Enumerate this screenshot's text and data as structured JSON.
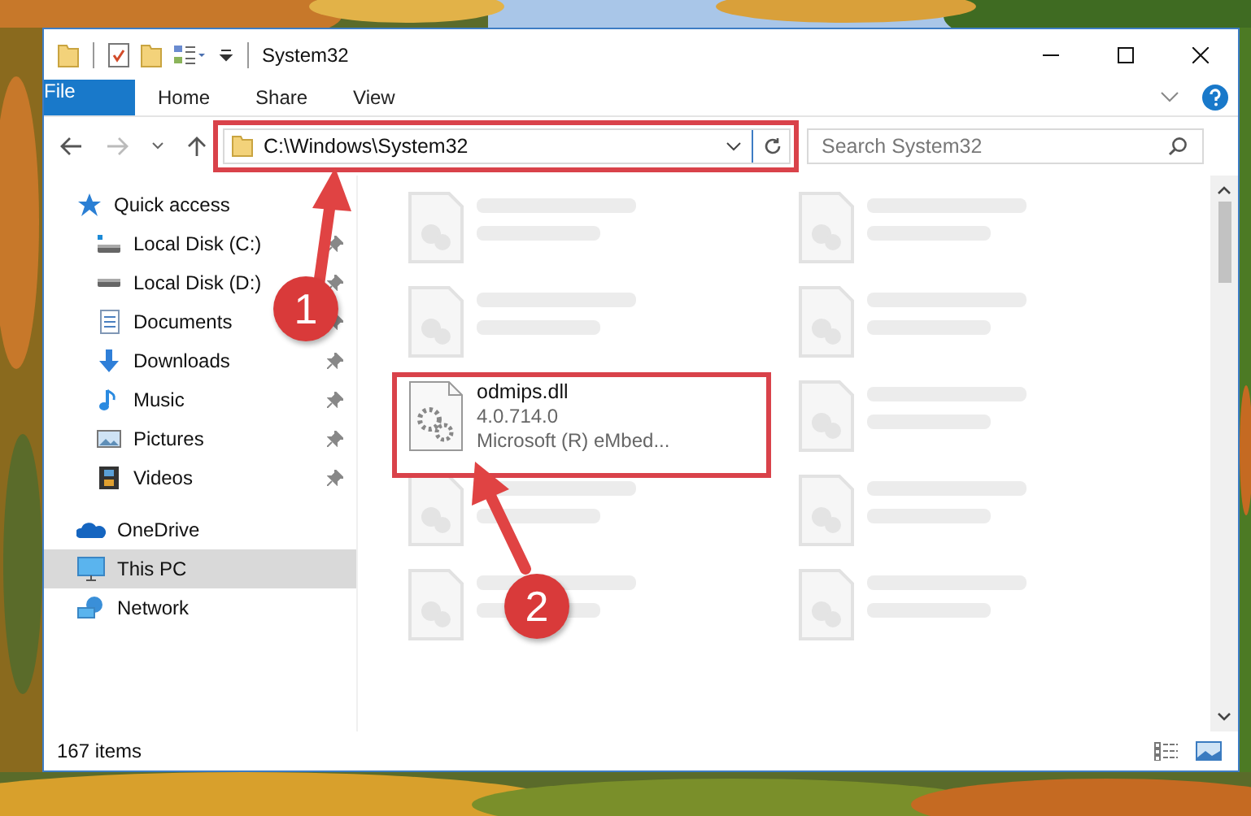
{
  "window": {
    "title": "System32"
  },
  "file_menu": {
    "label": "File"
  },
  "ribbon_tabs": [
    {
      "label": "Home",
      "selected": false
    },
    {
      "label": "Share",
      "selected": false
    },
    {
      "label": "View",
      "selected": false
    }
  ],
  "address_bar": {
    "value": "C:\\Windows\\System32"
  },
  "search": {
    "placeholder": "Search System32"
  },
  "sidebar": {
    "items": [
      {
        "label": "Quick access",
        "kind": "star",
        "selected": false,
        "children": [
          {
            "label": "Local Disk (C:)",
            "kind": "drive-win",
            "pinned": true,
            "selected": false
          },
          {
            "label": "Local Disk (D:)",
            "kind": "drive",
            "pinned": true,
            "selected": false
          },
          {
            "label": "Documents",
            "kind": "documents",
            "pinned": true,
            "selected": false
          },
          {
            "label": "Downloads",
            "kind": "downloads",
            "pinned": true,
            "selected": false
          },
          {
            "label": "Music",
            "kind": "music",
            "pinned": true,
            "selected": false
          },
          {
            "label": "Pictures",
            "kind": "pictures",
            "pinned": true,
            "selected": false
          },
          {
            "label": "Videos",
            "kind": "videos",
            "pinned": true,
            "selected": false
          }
        ]
      },
      {
        "label": "OneDrive",
        "kind": "cloud",
        "selected": false
      },
      {
        "label": "This PC",
        "kind": "pc",
        "selected": true
      },
      {
        "label": "Network",
        "kind": "network",
        "selected": false
      }
    ]
  },
  "files": [
    {
      "kind": "blurred"
    },
    {
      "kind": "blurred"
    },
    {
      "kind": "blurred"
    },
    {
      "kind": "blurred"
    },
    {
      "kind": "file",
      "name": "odmips.dll",
      "lines": [
        "4.0.714.0",
        "Microsoft (R) eMbed..."
      ]
    },
    {
      "kind": "blurred"
    },
    {
      "kind": "blurred"
    },
    {
      "kind": "blurred"
    },
    {
      "kind": "blurred"
    },
    {
      "kind": "blurred"
    }
  ],
  "status_bar": {
    "item_count": "167 items"
  },
  "annotations": [
    {
      "label": "1"
    },
    {
      "label": "2"
    }
  ]
}
